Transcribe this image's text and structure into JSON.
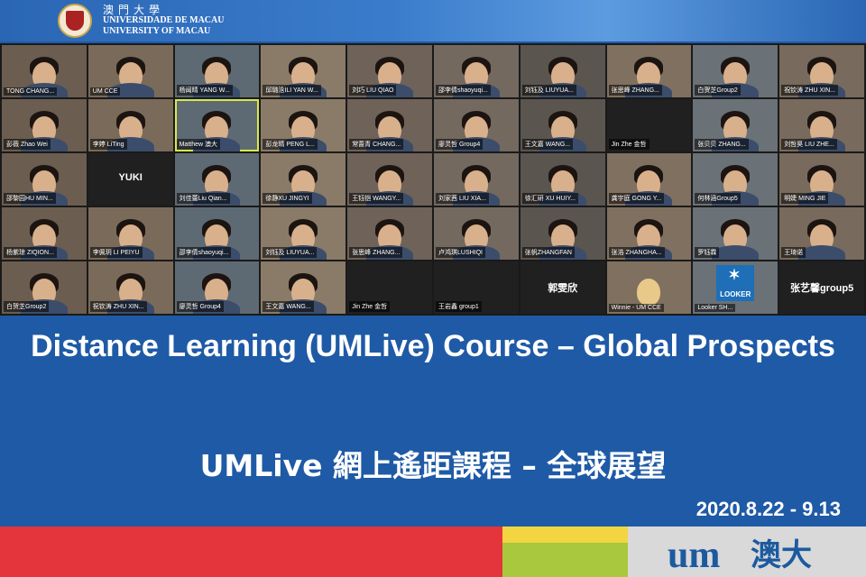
{
  "header": {
    "logo_zh": "澳門大學",
    "logo_pt": "UNIVERSIDADE DE MACAU",
    "logo_en": "UNIVERSITY OF MACAU"
  },
  "participants": [
    "TONG CHANG...",
    "UM CCE",
    "杨闻晴 YANG W...",
    "邱璐浛ILI YAN W...",
    "刘巧 LIU QIAO",
    "邵李倩shaoyuqi...",
    "刘钰及 LIUYUA...",
    "张思峰 ZHANG...",
    "白贺芝Group2",
    "祝钦涛 ZHU XIN...",
    "彭薇 Zhao Wei",
    "李婷 LiTing",
    "Matthew 澳大",
    "彭龙晴 PENG L...",
    "常蔷青 CHANG...",
    "廖灵哲 Group4",
    "王文嘉 WANG...",
    "Jin Zhe 金哲",
    "张贝贝 ZHANG...",
    "刘哲昊 LIU ZHE...",
    "邵黎园HU MIN...",
    "YUKI",
    "刘佳蕾Liu Qian...",
    "徐静XU JINGYI",
    "王钰铠 WANGY...",
    "刘家茜 LIU XIA...",
    "徐汇研 XU HUIY...",
    "龚宇庭 GONG Y...",
    "何林涵Group5",
    "明婕 MING JIE",
    "杨紫琼 ZIQION...",
    "李佩玥 LI PEIYU",
    "邵李倩shaoyuqi...",
    "刘钰及 LIUYUA...",
    "张思峰 ZHANG...",
    "卢鸿琪LUSHIQI",
    "张帆ZHANGFAN",
    "张浩 ZHANGHA...",
    "罗钰霖",
    "王琦诺",
    "白贺芝Group2",
    "祝钦涛 ZHU XIN...",
    "廖灵哲 Group4",
    "王文嘉 WANG...",
    "Jin Zhe 金哲",
    "王岩鑫 group1",
    "郭雯欣",
    "Winnie - UM CCE",
    "Looker SH...",
    "张艺馨group5"
  ],
  "looker_logo": "LOOKER",
  "title_en": "Distance Learning (UMLive) Course – Global Prospects",
  "title_zh": "UMLive 網上遙距課程 – 全球展望",
  "dates": "2020.8.22 - 9.13",
  "footer": {
    "um_mark": "um",
    "um_zh": "澳大"
  }
}
